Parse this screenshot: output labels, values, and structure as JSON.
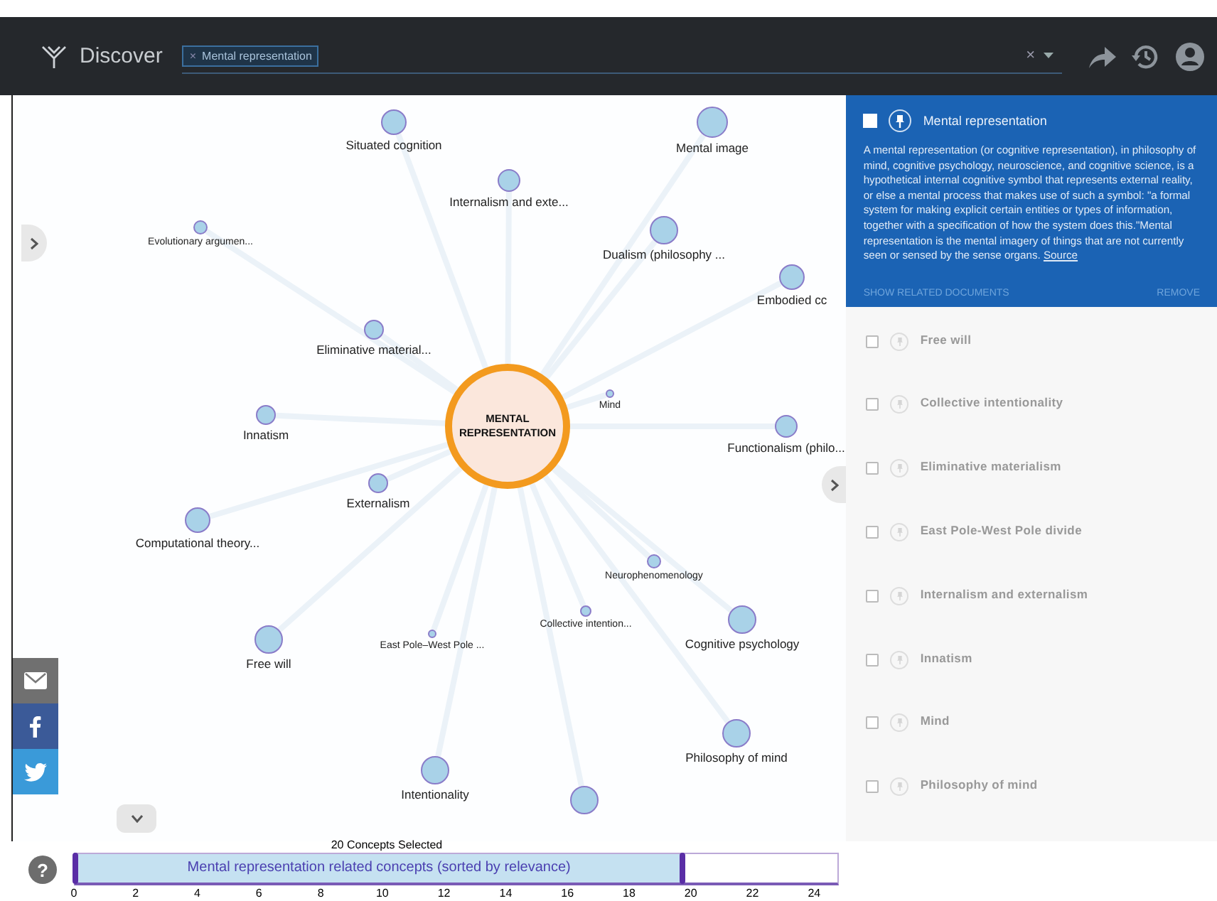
{
  "app": {
    "title": "Discover"
  },
  "search": {
    "tags": [
      {
        "remove": "×",
        "label": "Mental representation"
      }
    ],
    "clear": "×"
  },
  "graph": {
    "center": {
      "label": "MENTAL REPRESENTATION"
    },
    "nodes": [
      {
        "label": "Situated cognition"
      },
      {
        "label": "Mental image"
      },
      {
        "label": "Internalism and exte..."
      },
      {
        "label": "Evolutionary argumen..."
      },
      {
        "label": "Dualism (philosophy ..."
      },
      {
        "label": "Embodied cc"
      },
      {
        "label": "Eliminative material..."
      },
      {
        "label": "Mind"
      },
      {
        "label": "Innatism"
      },
      {
        "label": "Functionalism (philo..."
      },
      {
        "label": "Externalism"
      },
      {
        "label": "Computational theory..."
      },
      {
        "label": "Neurophenomenology"
      },
      {
        "label": "Collective intention..."
      },
      {
        "label": "East Pole–West Pole ..."
      },
      {
        "label": "Cognitive psychology"
      },
      {
        "label": "Free will"
      },
      {
        "label": "Philosophy of mind"
      },
      {
        "label": "Intentionality"
      },
      {
        "kind": "unlabeled"
      }
    ]
  },
  "detail": {
    "title": "Mental representation",
    "checked": false,
    "text": "A mental representation (or cognitive representation), in philosophy of mind, cognitive psychology, neuroscience, and cognitive science, is a hypothetical internal cognitive symbol that represents external reality, or else a mental process that makes use of such a symbol: \"a formal system for making explicit certain entities or types of information, together with a specification of how the system does this.\"Mental representation is the mental imagery of things that are not currently seen or sensed by the sense organs.",
    "source": "Source",
    "show_related": "SHOW RELATED DOCUMENTS",
    "remove": "REMOVE"
  },
  "concepts": [
    {
      "label": "Free will",
      "checked": false
    },
    {
      "label": "Collective intentionality",
      "checked": false
    },
    {
      "label": "Eliminative materialism",
      "checked": false
    },
    {
      "label": "East Pole-West Pole divide",
      "checked": false
    },
    {
      "label": "Internalism and externalism",
      "checked": false
    },
    {
      "label": "Innatism",
      "checked": false
    },
    {
      "label": "Mind",
      "checked": false
    },
    {
      "label": "Philosophy of mind",
      "checked": false
    }
  ],
  "timeline": {
    "caption": "20 Concepts Selected",
    "label": "Mental representation related concepts (sorted by relevance)",
    "level": 0.797,
    "ticks": [
      "0",
      "2",
      "4",
      "6",
      "8",
      "10",
      "12",
      "14",
      "16",
      "18",
      "20",
      "22",
      "24"
    ]
  },
  "help": "?"
}
